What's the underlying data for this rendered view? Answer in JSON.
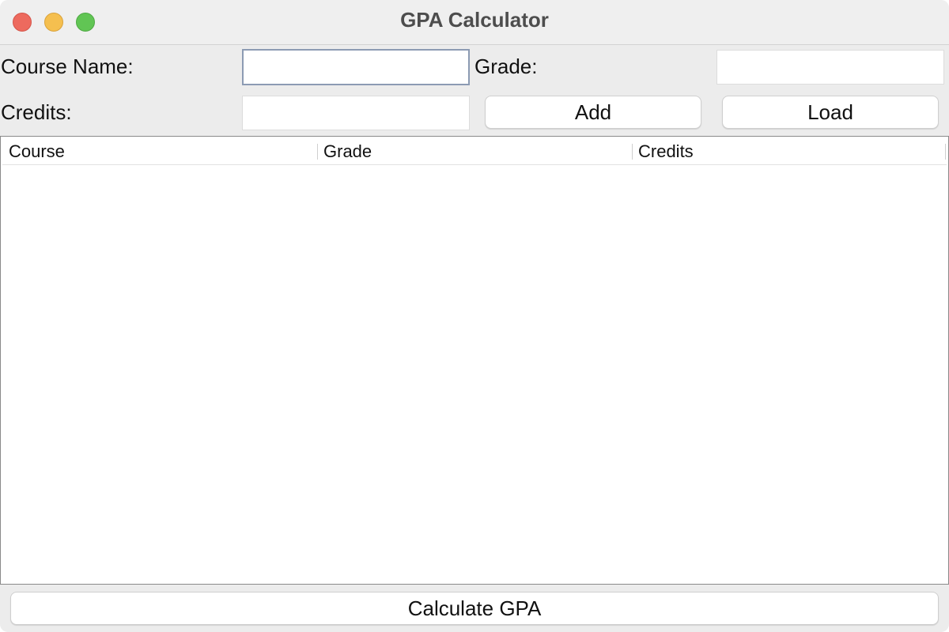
{
  "window": {
    "title": "GPA Calculator"
  },
  "form": {
    "course_name_label": "Course Name:",
    "course_name_value": "",
    "grade_label": "Grade:",
    "grade_value": "",
    "credits_label": "Credits:",
    "credits_value": "",
    "add_label": "Add",
    "load_label": "Load"
  },
  "table": {
    "columns": [
      "Course",
      "Grade",
      "Credits"
    ],
    "rows": []
  },
  "footer": {
    "calculate_label": "Calculate GPA"
  },
  "colors": {
    "close": "#ed6a5e",
    "minimize": "#f5bf4f",
    "maximize": "#61c554"
  }
}
